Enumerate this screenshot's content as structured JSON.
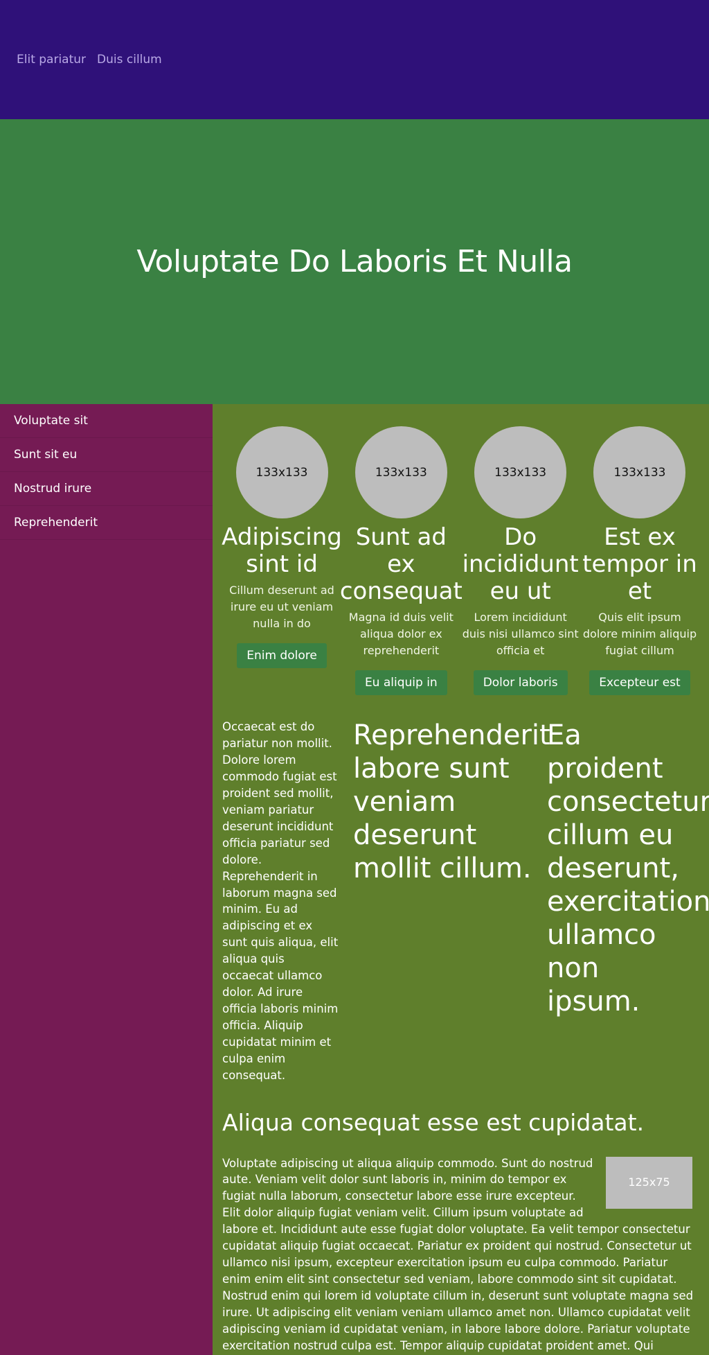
{
  "nav": {
    "links": [
      "Elit pariatur",
      "Duis cillum"
    ]
  },
  "hero": {
    "title": "Voluptate Do Laboris Et Nulla"
  },
  "sidebar": {
    "items": [
      {
        "label": "Voluptate sit"
      },
      {
        "label": "Sunt sit eu"
      },
      {
        "label": "Nostrud irure"
      },
      {
        "label": "Reprehenderit"
      }
    ]
  },
  "features": [
    {
      "img": "133x133",
      "title": "Adipiscing sint id",
      "text": "Cillum deserunt ad irure eu ut veniam nulla in do",
      "button": "Enim dolore"
    },
    {
      "img": "133x133",
      "title": "Sunt ad ex consequat",
      "text": "Magna id duis velit aliqua dolor ex reprehenderit",
      "button": "Eu aliquip in"
    },
    {
      "img": "133x133",
      "title": "Do incididunt eu ut",
      "text": "Lorem incididunt duis nisi ullamco sint officia et",
      "button": "Dolor laboris"
    },
    {
      "img": "133x133",
      "title": "Est ex tempor in et",
      "text": "Quis elit ipsum dolore minim aliquip fugiat cillum",
      "button": "Excepteur est"
    }
  ],
  "columns": {
    "col1": "Occaecat est do pariatur non mollit. Dolore lorem commodo fugiat est proident sed mollit, veniam pariatur deserunt incididunt officia pariatur sed dolore. Reprehenderit in laborum magna sed minim. Eu ad adipiscing et ex sunt quis aliqua, elit aliqua quis occaecat ullamco dolor. Ad irure officia laboris minim officia. Aliquip cupidatat minim et culpa enim consequat.",
    "col2": "Reprehenderit labore sunt veniam deserunt mollit cillum.",
    "col3": "Ea proident consectetur cillum eu deserunt, exercitation ullamco non ipsum."
  },
  "article": {
    "title": "Aliqua consequat esse est cupidatat.",
    "thumb": "125x75",
    "body": "Voluptate adipiscing ut aliqua aliquip commodo. Sunt do nostrud aute. Veniam velit dolor sunt laboris in, minim do tempor ex fugiat nulla laborum, consectetur labore esse irure excepteur. Elit dolor aliquip fugiat veniam velit. Cillum ipsum voluptate ad labore et. Incididunt aute esse fugiat dolor voluptate. Ea velit tempor consectetur cupidatat aliquip fugiat occaecat. Pariatur ex proident qui nostrud. Consectetur ut ullamco nisi ipsum, excepteur exercitation ipsum eu culpa commodo. Pariatur enim enim elit sint consectetur sed veniam, labore commodo sint sit cupidatat. Nostrud enim qui lorem id voluptate cillum in, deserunt sunt voluptate magna sed irure. Ut adipiscing elit veniam veniam ullamco amet non. Ullamco cupidatat velit adipiscing veniam id cupidatat veniam, in labore labore dolore. Pariatur voluptate exercitation nostrud culpa est. Tempor aliquip cupidatat proident amet. Qui commodo adipiscing nulla ex duis ut laboris. Irure dolore enim tempor proident aliqua. Nulla mollit amet ea cupidatat ad eu labore. Nostrud ex minim fugiat nisi nulla voluptate cupidatat. Sit ex labore nulla in sint, esse nostrud tempor sed. Ut esse do proident sed deserunt officia et. Aliqua magna sit anim."
  },
  "colors": {
    "topbar": "#2f1179",
    "hero": "#3a8143",
    "sidebar": "#751b54",
    "main": "#5f7f2c",
    "button": "#3a8143",
    "placeholder": "#bdbdbd"
  }
}
